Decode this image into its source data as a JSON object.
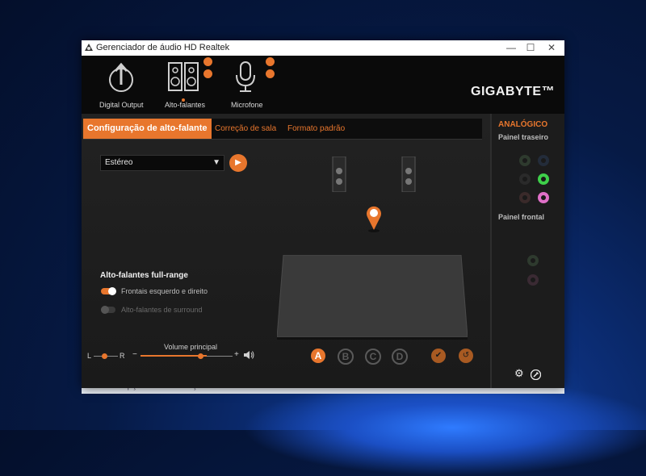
{
  "window": {
    "title": "Gerenciador de áudio HD Realtek",
    "minimize": "—",
    "maximize": "☐",
    "close": "✕"
  },
  "devices": [
    {
      "label": "Digital Output",
      "icon": "digital-output-icon"
    },
    {
      "label": "Alto-falantes",
      "icon": "speakers-icon"
    },
    {
      "label": "Microfone",
      "icon": "microphone-icon"
    }
  ],
  "brand": "GIGABYTE™",
  "tabs": [
    {
      "label": "Configuração de alto-falante",
      "active": true
    },
    {
      "label": "Correção de sala",
      "active": false
    },
    {
      "label": "Formato padrão",
      "active": false
    }
  ],
  "speaker_config": {
    "selected": "Estéreo"
  },
  "full_range": {
    "title": "Alto-falantes full-range",
    "front_label": "Frontais esquerdo e direito",
    "front_on": true,
    "surround_label": "Alto-falantes de surround",
    "surround_on": false
  },
  "volume": {
    "title": "Volume principal",
    "balance_left": "L",
    "balance_right": "R",
    "minus": "−",
    "plus": "+",
    "level": 0.72,
    "balance": 0.5
  },
  "presets": [
    "A",
    "B",
    "C",
    "D"
  ],
  "analog": {
    "title": "ANALÓGICO",
    "rear_panel": "Painel traseiro",
    "front_panel": "Painel frontal"
  },
  "colors": {
    "accent": "#e8762d",
    "green_jack": "#3ecf4a",
    "pink_jack": "#e070c8"
  },
  "taskbar_behind": {
    "left": "Opções de Indexação",
    "right": "Portas de trabalho"
  }
}
